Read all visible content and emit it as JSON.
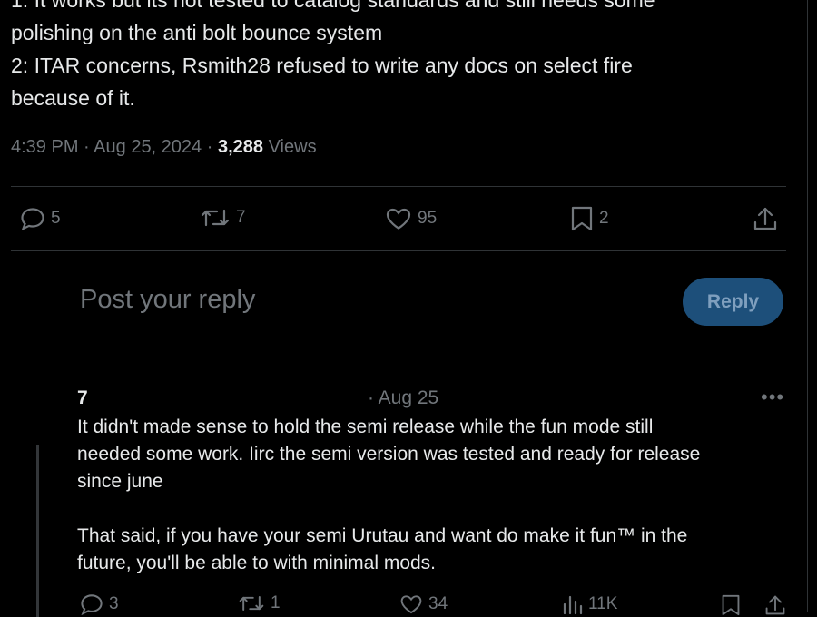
{
  "post": {
    "lines": [
      "1: It works but its not tested to catalog standards and still needs some",
      "polishing on the anti bolt bounce system",
      "2: ITAR concerns, Rsmith28 refused to write any docs on select fire",
      "because of it."
    ],
    "time": "4:39 PM",
    "date": "Aug 25, 2024",
    "views_count": "3,288",
    "views_label": "Views"
  },
  "actions": {
    "replies": "5",
    "reposts": "7",
    "likes": "95",
    "bookmarks": "2"
  },
  "composer": {
    "placeholder": "Post your reply",
    "button_label": "Reply"
  },
  "reply": {
    "author": "7",
    "date": "· Aug 25",
    "lines": [
      "It didn't made sense to hold the semi release while the fun mode still",
      "needed some work. Iirc the semi version was tested and ready for release",
      "since june",
      "",
      "That said, if you have your semi Urutau and want do make it fun™ in the",
      "future, you'll be able to with minimal mods."
    ],
    "replies": "3",
    "reposts": "1",
    "likes": "34",
    "views": "11K"
  },
  "colors": {
    "background": "#000000",
    "text": "#e7e9ea",
    "muted": "#71767b",
    "divider": "#2f3336",
    "reply_button": "#1d4f7a"
  }
}
